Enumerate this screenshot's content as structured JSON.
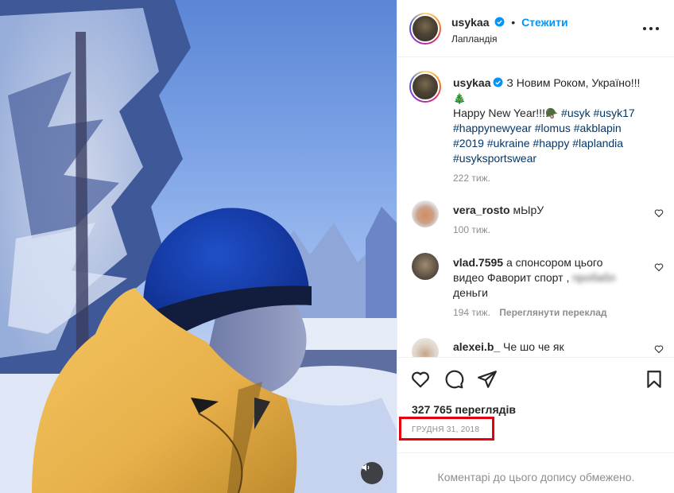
{
  "post": {
    "author": "usykaa",
    "follow_label": "Стежити",
    "dot": "•",
    "location": "Лапландія"
  },
  "caption": {
    "text_prefix": "З Новим Роком, Україно!!!",
    "emoji_tree": "🎄",
    "text_line2": "Happy New Year!!!",
    "emoji_hat": "🪖",
    "hashtags_line1": "#usyk #usyk17",
    "hashtags_line2": "#happynewyear #lomus #akblapin",
    "hashtags_line3": "#2019 #ukraine #happy #laplandia",
    "hashtags_line4": "#usyksportswear",
    "time": "222 тиж."
  },
  "comments": [
    {
      "user": "vera_rosto",
      "text": "мЫрУ",
      "time": "100 тиж."
    },
    {
      "user": "vlad.7595",
      "text_line1": "а спонсором цього",
      "text_line2": "видео Фаворит спорт ,",
      "blurred": "пробабл",
      "text_line3": "деньги",
      "time": "194 тиж.",
      "translate": "Переглянути переклад"
    },
    {
      "user": "alexei.b_",
      "text": "Че шо че як"
    }
  ],
  "stats": {
    "views": "327 765 переглядів",
    "date": "ГРУДНЯ 31, 2018"
  },
  "footer": {
    "comments_disabled": "Коментарі до цього допису обмежено."
  },
  "icons": {
    "like": "heart-icon",
    "comment": "comment-icon",
    "share": "share-icon",
    "save": "bookmark-icon",
    "more": "more-icon",
    "mute": "speaker-icon"
  },
  "colors": {
    "follow_blue": "#0095f6",
    "hashtag": "#00376b",
    "verified": "#0095f6",
    "highlight": "#e3000f"
  }
}
